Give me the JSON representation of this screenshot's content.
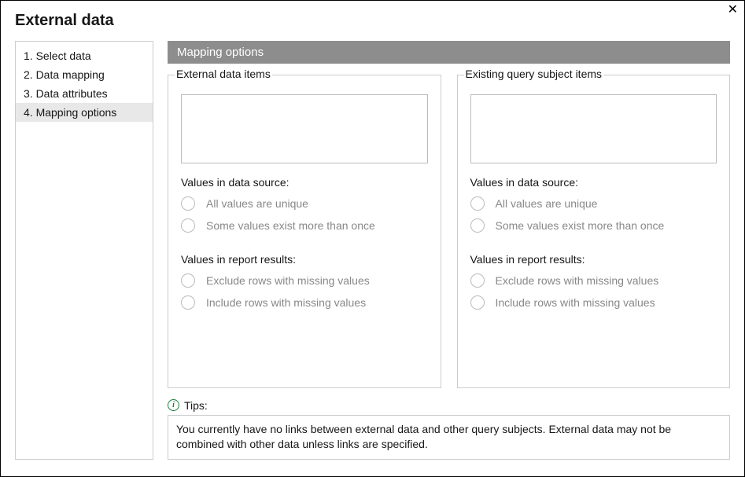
{
  "dialog": {
    "title": "External data"
  },
  "sidebar": {
    "items": [
      {
        "label": "1. Select data"
      },
      {
        "label": "2. Data mapping"
      },
      {
        "label": "3. Data attributes"
      },
      {
        "label": "4. Mapping options"
      }
    ],
    "active_index": 3
  },
  "main": {
    "header": "Mapping options",
    "left": {
      "legend": "External data items",
      "source_label": "Values in data source:",
      "source_options": [
        "All values are unique",
        "Some values exist more than once"
      ],
      "results_label": "Values in report results:",
      "results_options": [
        "Exclude rows with missing values",
        "Include rows with missing values"
      ]
    },
    "right": {
      "legend": "Existing query subject items",
      "source_label": "Values in data source:",
      "source_options": [
        "All values are unique",
        "Some values exist more than once"
      ],
      "results_label": "Values in report results:",
      "results_options": [
        "Exclude rows with missing values",
        "Include rows with missing values"
      ]
    }
  },
  "tips": {
    "label": "Tips:",
    "text": "You currently have no links between external data and other query subjects. External data may not be combined with other data unless links are specified."
  }
}
